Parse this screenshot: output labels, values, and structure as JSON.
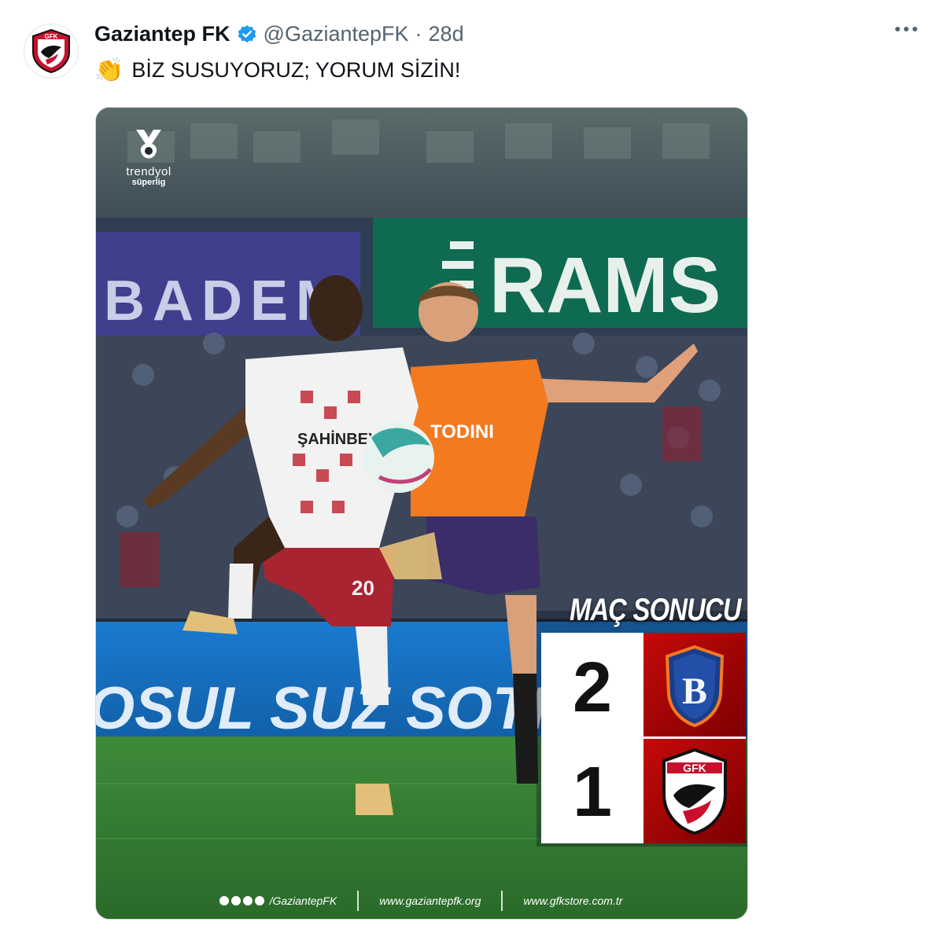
{
  "tweet": {
    "author_name": "Gaziantep FK",
    "handle": "@GaziantepFK",
    "separator": "·",
    "time": "28d",
    "emoji": "👏",
    "text": "BİZ SUSUYORUZ; YORUM SİZİN!"
  },
  "media": {
    "league_logo_line1": "trendyol",
    "league_logo_line2": "süperlig",
    "sign_left": "BADEM",
    "sign_right": "RAMS",
    "jersey_sponsor_white": "ŞAHİNBEY",
    "jersey_sponsor_orange": "TODINI",
    "jersey_number": "20",
    "ad_board": "OSUL SUZ SOTI",
    "result_title": "MAÇ SONUCU",
    "home_score": "2",
    "away_score": "1",
    "away_logo_text": "GFK",
    "footer_social": "/GaziantepFK",
    "footer_site": "www.gaziantepfk.org",
    "footer_store": "www.gfkstore.com.tr"
  },
  "colors": {
    "accent_red": "#c40a0a",
    "verified_blue": "#1d9bf0",
    "orange_kit": "#f47a20"
  }
}
